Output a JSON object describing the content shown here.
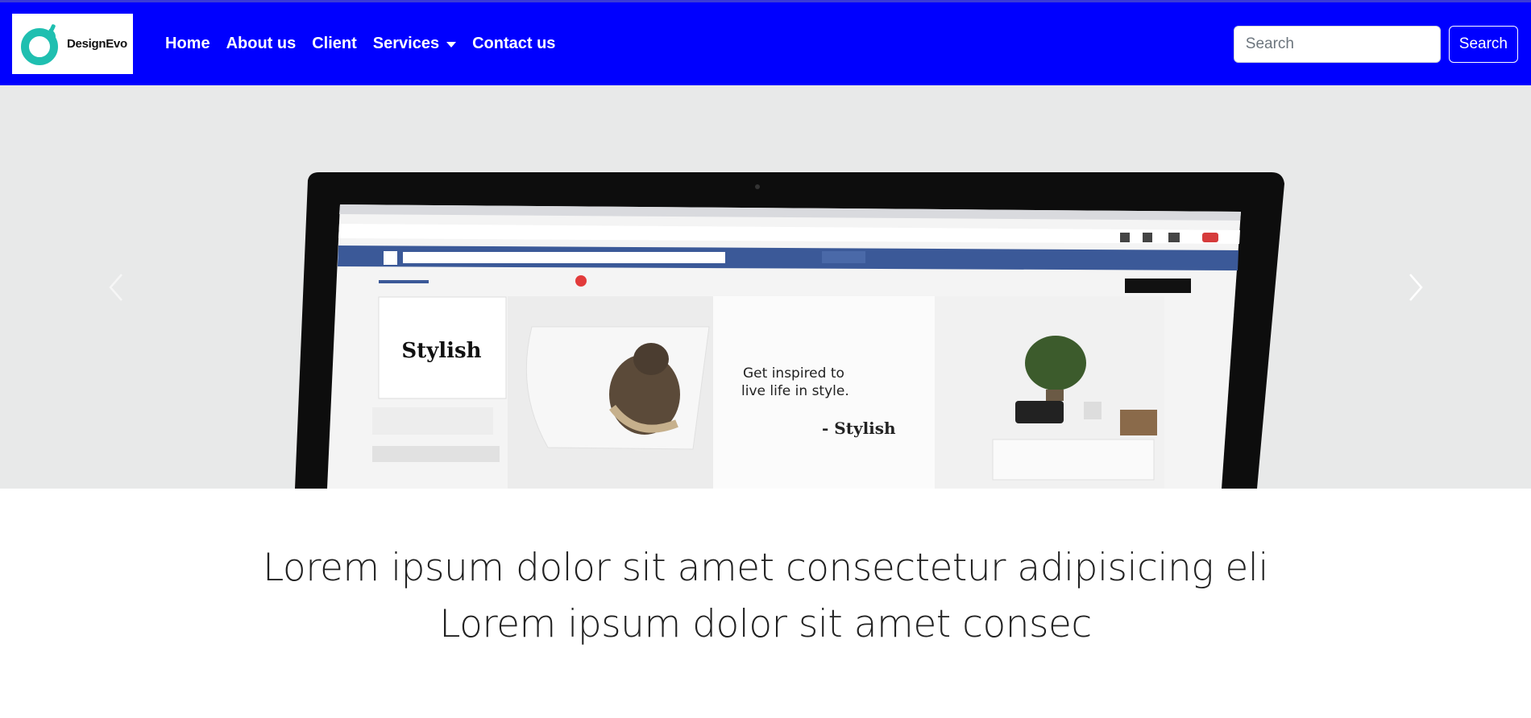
{
  "navbar": {
    "brand": {
      "name": "DesignEvo",
      "logo_icon": "designevo-logo-icon",
      "accent": "#1fbfb0"
    },
    "background": "#0000ff",
    "items": [
      {
        "label": "Home"
      },
      {
        "label": "About us"
      },
      {
        "label": "Client"
      },
      {
        "label": "Services",
        "has_dropdown": true
      },
      {
        "label": "Contact us"
      }
    ],
    "search": {
      "placeholder": "Search",
      "value": "",
      "button_label": "Search"
    }
  },
  "carousel": {
    "image": "laptop-facebook-page-photo",
    "prev_icon": "chevron-left-icon",
    "next_icon": "chevron-right-icon"
  },
  "caption": {
    "line1": "Lorem ipsum dolor sit amet consectetur adipisicing eli",
    "line2": "Lorem ipsum dolor sit amet consec"
  }
}
